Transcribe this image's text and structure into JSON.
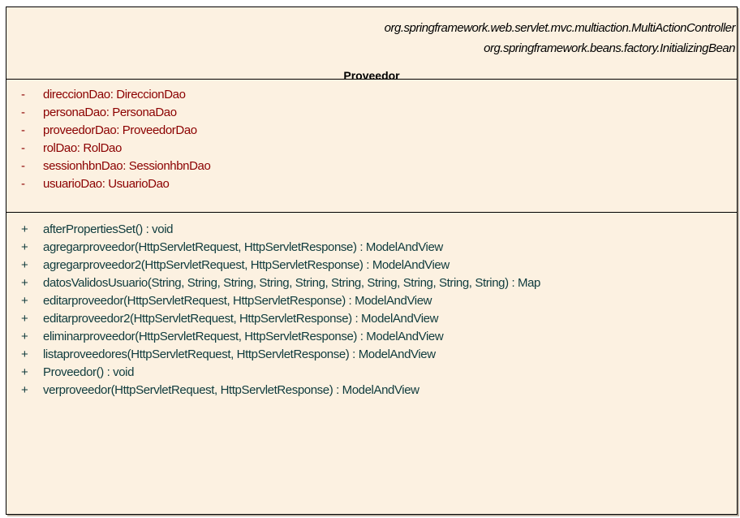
{
  "class": {
    "interfaces": [
      "org.springframework.web.servlet.mvc.multiaction.MultiActionController",
      "org.springframework.beans.factory.InitializingBean"
    ],
    "name": "Proveedor",
    "attributes": [
      {
        "visibility": "-",
        "text": "direccionDao:  DireccionDao"
      },
      {
        "visibility": "-",
        "text": "personaDao:  PersonaDao"
      },
      {
        "visibility": "-",
        "text": "proveedorDao:  ProveedorDao"
      },
      {
        "visibility": "-",
        "text": "rolDao:  RolDao"
      },
      {
        "visibility": "-",
        "text": "sessionhbnDao:  SessionhbnDao"
      },
      {
        "visibility": "-",
        "text": "usuarioDao:  UsuarioDao"
      }
    ],
    "operations": [
      {
        "visibility": "+",
        "text": "afterPropertiesSet() : void"
      },
      {
        "visibility": "+",
        "text": "agregarproveedor(HttpServletRequest, HttpServletResponse) : ModelAndView"
      },
      {
        "visibility": "+",
        "text": "agregarproveedor2(HttpServletRequest, HttpServletResponse) : ModelAndView"
      },
      {
        "visibility": "+",
        "text": "datosValidosUsuario(String, String, String, String, String, String, String, String, String, String) : Map"
      },
      {
        "visibility": "+",
        "text": "editarproveedor(HttpServletRequest, HttpServletResponse) : ModelAndView"
      },
      {
        "visibility": "+",
        "text": "editarproveedor2(HttpServletRequest, HttpServletResponse) : ModelAndView"
      },
      {
        "visibility": "+",
        "text": "eliminarproveedor(HttpServletRequest, HttpServletResponse) : ModelAndView"
      },
      {
        "visibility": "+",
        "text": "listaproveedores(HttpServletRequest, HttpServletResponse) : ModelAndView"
      },
      {
        "visibility": "+",
        "text": "Proveedor() : void"
      },
      {
        "visibility": "+",
        "text": "verproveedor(HttpServletRequest, HttpServletResponse) : ModelAndView"
      }
    ]
  },
  "colors": {
    "background": "#fcf1e1",
    "attribute_text": "#8b0000",
    "operation_text": "#0f3b3d",
    "border": "#000000"
  }
}
